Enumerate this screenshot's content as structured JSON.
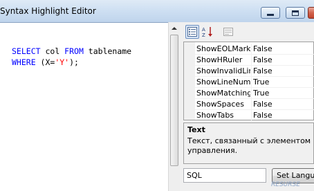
{
  "window": {
    "title": "Syntax Highlight Editor"
  },
  "editor": {
    "lines": [
      {
        "parts": [
          {
            "t": "SELECT",
            "c": "kw"
          },
          {
            "t": " col ",
            "c": "plain"
          },
          {
            "t": "FROM",
            "c": "kw"
          },
          {
            "t": " tablename",
            "c": "plain"
          }
        ]
      },
      {
        "parts": [
          {
            "t": "WHERE",
            "c": "kw"
          },
          {
            "t": " (X=",
            "c": "plain"
          },
          {
            "t": "'Y'",
            "c": "str"
          },
          {
            "t": ");",
            "c": "plain"
          }
        ]
      }
    ]
  },
  "property_grid": {
    "toolbar": {
      "categorized_icon": "categorized-icon",
      "alphabetical_icon": "alphabetical-icon",
      "property_pages_icon": "property-pages-icon"
    },
    "rows": [
      {
        "name": "ShowEOLMarker",
        "value": "False"
      },
      {
        "name": "ShowHRuler",
        "value": "False"
      },
      {
        "name": "ShowInvalidLines",
        "value": "False"
      },
      {
        "name": "ShowLineNumbers",
        "value": "True"
      },
      {
        "name": "ShowMatchingBracket",
        "value": "True"
      },
      {
        "name": "ShowSpaces",
        "value": "False"
      },
      {
        "name": "ShowTabs",
        "value": "False"
      }
    ],
    "description": {
      "title": "Text",
      "text": "Текст, связанный с элементом управления."
    }
  },
  "language": {
    "input_value": "SQL",
    "button_label": "Set Language"
  },
  "watermark": "RESURSE",
  "colors": {
    "keyword": "#0000ff",
    "string": "#ff0000",
    "titlebar": "#cddff2"
  }
}
